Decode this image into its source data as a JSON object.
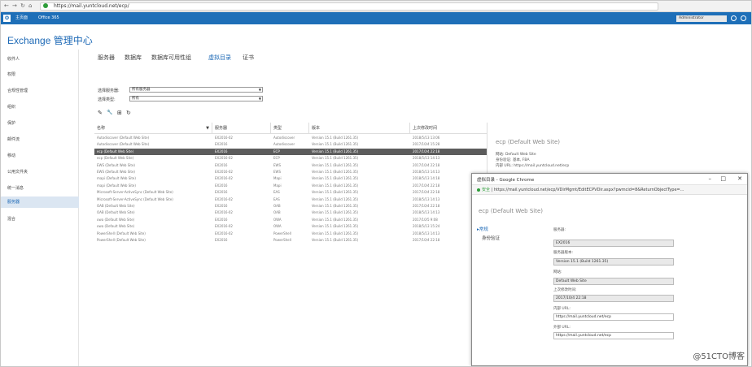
{
  "browser": {
    "url": "https://mail.yuntcloud.net/ecp/"
  },
  "o365": {
    "logo": "O",
    "admin_center": "主页面",
    "product": "Office 365",
    "user": "Administrator"
  },
  "app_title": "Exchange 管理中心",
  "left_nav": {
    "items": [
      {
        "label": "收件人"
      },
      {
        "label": "权限"
      },
      {
        "label": "合规性管理"
      },
      {
        "label": "组织"
      },
      {
        "label": "保护"
      },
      {
        "label": "邮件流"
      },
      {
        "label": "移动"
      },
      {
        "label": "公用文件夹"
      },
      {
        "label": "统一消息"
      },
      {
        "label": "服务器"
      },
      {
        "label": "混合"
      }
    ],
    "selected": "服务器"
  },
  "tabs": [
    {
      "label": "服务器"
    },
    {
      "label": "数据库"
    },
    {
      "label": "数据库可用性组"
    },
    {
      "label": "虚拟目录"
    },
    {
      "label": "证书"
    }
  ],
  "selected_tab": "虚拟目录",
  "filters": {
    "server_label": "选择服务器:",
    "server_value": "所有服务器",
    "type_label": "选择类型:",
    "type_value": "所有"
  },
  "toolbar": {
    "edit": "✎",
    "configure": "🔧",
    "reset": "⊞",
    "refresh": "↻"
  },
  "table": {
    "columns": [
      "名称",
      "服务器",
      "类型",
      "版本",
      "上次修改时间"
    ],
    "rows": [
      [
        "Autodiscover (Default Web Site)",
        "EX2016-02",
        "Autodiscover",
        "Version 15.1 (Build 1261.35)",
        "2018/5/13 13:06"
      ],
      [
        "Autodiscover (Default Web Site)",
        "EX2016",
        "Autodiscover",
        "Version 15.1 (Build 1261.35)",
        "2017/10/4 15:28"
      ],
      [
        "ecp (Default Web Site)",
        "EX2016",
        "ECP",
        "Version 15.1 (Build 1261.35)",
        "2017/10/4 22:18"
      ],
      [
        "ecp (Default Web Site)",
        "EX2016-02",
        "ECP",
        "Version 15.1 (Build 1261.35)",
        "2018/5/13 14:13"
      ],
      [
        "EWS (Default Web Site)",
        "EX2016",
        "EWS",
        "Version 15.1 (Build 1261.35)",
        "2017/10/4 22:18"
      ],
      [
        "EWS (Default Web Site)",
        "EX2016-02",
        "EWS",
        "Version 15.1 (Build 1261.35)",
        "2018/5/13 14:13"
      ],
      [
        "mapi (Default Web Site)",
        "EX2016-02",
        "Mapi",
        "Version 15.1 (Build 1261.35)",
        "2018/5/13 14:18"
      ],
      [
        "mapi (Default Web Site)",
        "EX2016",
        "Mapi",
        "Version 15.1 (Build 1261.35)",
        "2017/10/4 22:18"
      ],
      [
        "Microsoft-Server-ActiveSync (Default Web Site)",
        "EX2016",
        "EAS",
        "Version 15.1 (Build 1261.35)",
        "2017/10/4 22:18"
      ],
      [
        "Microsoft-Server-ActiveSync (Default Web Site)",
        "EX2016-02",
        "EAS",
        "Version 15.1 (Build 1261.35)",
        "2018/5/13 14:13"
      ],
      [
        "OAB (Default Web Site)",
        "EX2016",
        "OAB",
        "Version 15.1 (Build 1261.35)",
        "2017/10/4 22:18"
      ],
      [
        "OAB (Default Web Site)",
        "EX2016-02",
        "OAB",
        "Version 15.1 (Build 1261.35)",
        "2018/5/13 14:13"
      ],
      [
        "owa (Default Web Site)",
        "EX2016",
        "OWA",
        "Version 15.1 (Build 1261.35)",
        "2017/10/5 9:08"
      ],
      [
        "owa (Default Web Site)",
        "EX2016-02",
        "OWA",
        "Version 15.1 (Build 1261.35)",
        "2018/5/13 15:24"
      ],
      [
        "PowerShell (Default Web Site)",
        "EX2016-02",
        "PowerShell",
        "Version 15.1 (Build 1261.35)",
        "2018/5/13 14:13"
      ],
      [
        "PowerShell (Default Web Site)",
        "EX2016",
        "PowerShell",
        "Version 15.1 (Build 1261.35)",
        "2017/10/4 22:18"
      ]
    ],
    "selected_row": 2
  },
  "details": {
    "title": "ecp (Default Web Site)",
    "lines": [
      "网站: Default Web Site",
      "身份验证: 基本, FBA",
      "内部 URL: https://mail.yuntcloud.net/ecp"
    ]
  },
  "popup": {
    "window_title": "虚拟目录 - Google Chrome",
    "secure_label": "安全",
    "url": "https://mail.yuntcloud.net/ecp/VDirMgmt/EditECPVDir.aspx?pwmcid=8&ReturnObjectType=...",
    "heading": "ecp (Default Web Site)",
    "nav": [
      {
        "label": "常规"
      },
      {
        "label": "身份验证"
      }
    ],
    "fields": [
      {
        "label": "服务器:",
        "value": "EX2016"
      },
      {
        "label": "服务器版本:",
        "value": "Version 15.1 (Build 1261.35)"
      },
      {
        "label": "网站:",
        "value": "Default Web Site"
      },
      {
        "label": "上次修改时间:",
        "value": "2017/10/4 22:18"
      },
      {
        "label": "内部 URL:",
        "value": "https://mail.yuntcloud.net/ecp"
      },
      {
        "label": "外部 URL:",
        "value": "https://mail.yuntcloud.net/ecp"
      }
    ]
  },
  "watermark": "@51CTO博客",
  "colors": {
    "accent": "#1d69b6",
    "o365_bar": "#1e6fb8",
    "selected_row": "#5c5c5c"
  }
}
